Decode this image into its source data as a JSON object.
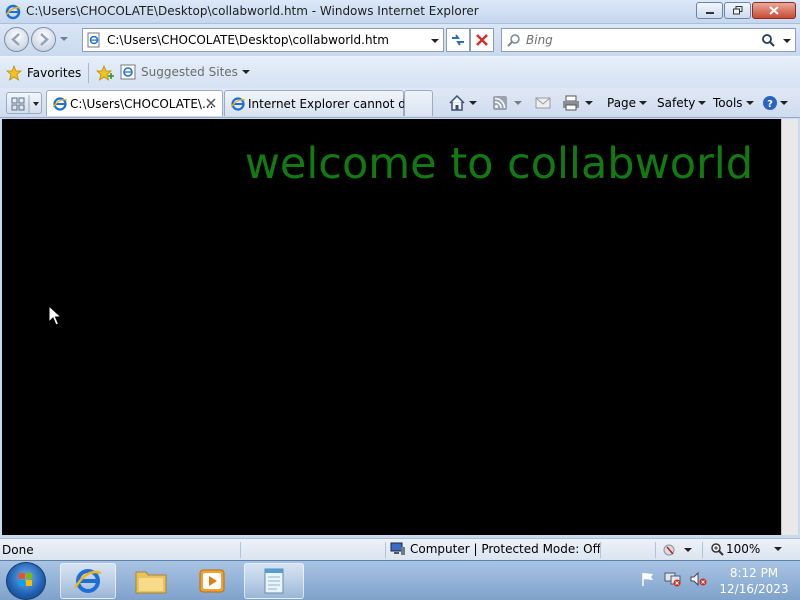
{
  "window": {
    "title": "C:\\Users\\CHOCOLATE\\Desktop\\collabworld.htm - Windows Internet Explorer"
  },
  "address_bar": {
    "url": "C:\\Users\\CHOCOLATE\\Desktop\\collabworld.htm"
  },
  "search": {
    "placeholder": "Bing"
  },
  "favorites_bar": {
    "favorites_label": "Favorites",
    "suggested_sites_label": "Suggested Sites"
  },
  "tabs": [
    {
      "label": "C:\\Users\\CHOCOLATE\\...",
      "active": true
    },
    {
      "label": "Internet Explorer cannot di...",
      "active": false
    }
  ],
  "command_bar": {
    "page_label": "Page",
    "safety_label": "Safety",
    "tools_label": "Tools"
  },
  "page": {
    "heading": "welcome to collabworld",
    "heading_color": "#117a11",
    "background_color": "#000000"
  },
  "status_bar": {
    "status": "Done",
    "zone": "Computer | Protected Mode: Off",
    "zoom": "100%"
  },
  "taskbar": {
    "time": "8:12 PM",
    "date": "12/16/2023"
  }
}
